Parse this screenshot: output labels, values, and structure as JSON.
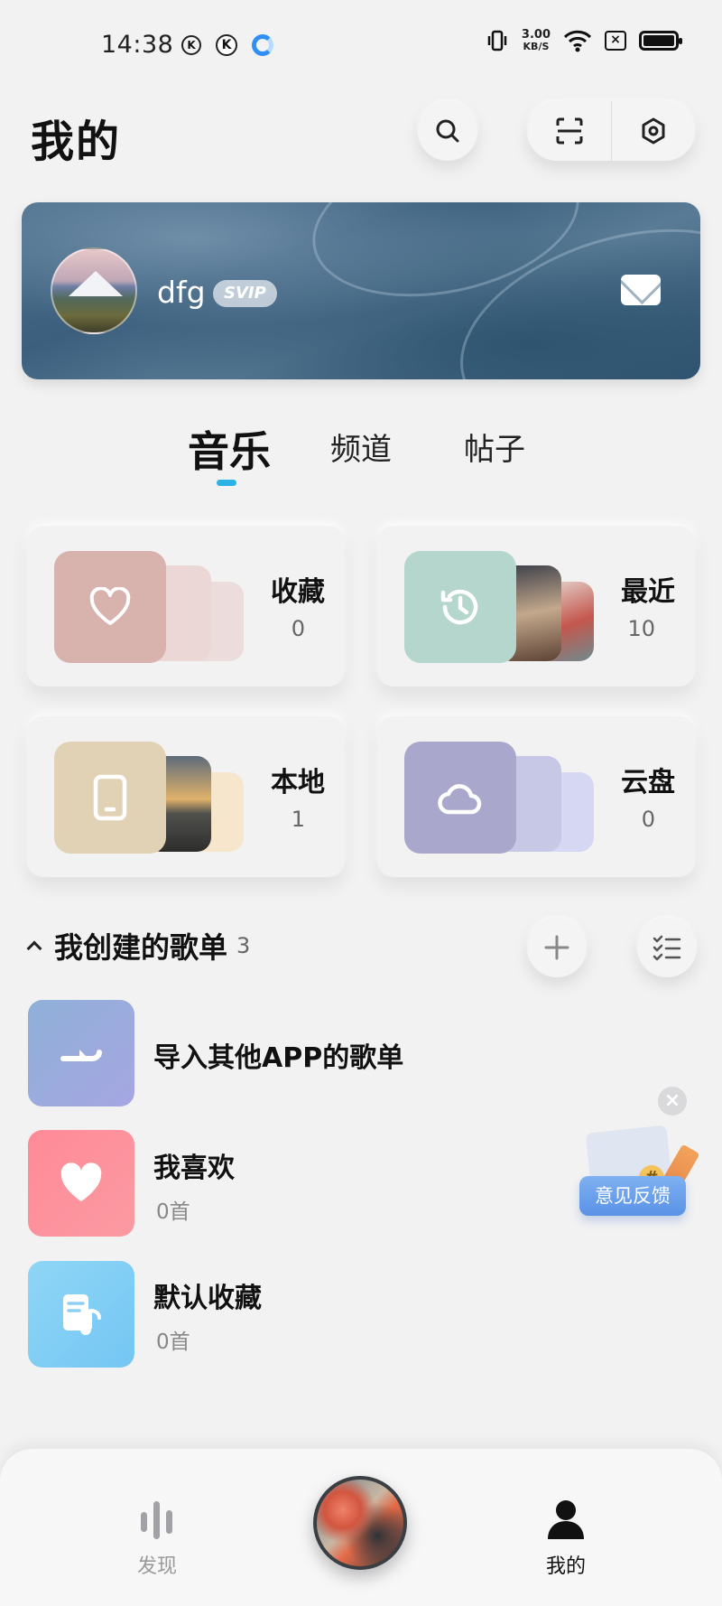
{
  "status_bar": {
    "time": "14:38",
    "k_badge": "K",
    "net_speed": "3.00",
    "net_unit": "KB/S"
  },
  "header": {
    "title": "我的",
    "search_icon": "search-icon",
    "scan_icon": "scan-icon",
    "settings_icon": "hexagon-settings-icon"
  },
  "profile": {
    "username": "dfg",
    "badge": "SVIP",
    "mail_icon": "mail-icon"
  },
  "tabs": [
    {
      "label": "音乐",
      "active": true
    },
    {
      "label": "频道",
      "active": false
    },
    {
      "label": "帖子",
      "active": false
    }
  ],
  "shortcuts": [
    {
      "label": "收藏",
      "count": "0",
      "icon": "heart-icon",
      "color": "#d8b2ad"
    },
    {
      "label": "最近",
      "count": "10",
      "icon": "clock-icon",
      "color": "#b4d6cc"
    },
    {
      "label": "本地",
      "count": "1",
      "icon": "phone-icon",
      "color": "#e1d2b6"
    },
    {
      "label": "云盘",
      "count": "0",
      "icon": "cloud-icon",
      "color": "#a9a8cc"
    }
  ],
  "playlists_section": {
    "title": "我创建的歌单",
    "count": "3"
  },
  "playlists": [
    {
      "title": "导入其他APP的歌单",
      "subtitle": "",
      "icon": "import-arrow-icon"
    },
    {
      "title": "我喜欢",
      "subtitle": "0首",
      "icon": "heart-icon"
    },
    {
      "title": "默认收藏",
      "subtitle": "0首",
      "icon": "music-note-doc-icon"
    }
  ],
  "feedback": {
    "label": "意见反馈",
    "close": "×",
    "hash": "#"
  },
  "bottom_nav": {
    "discover": "发现",
    "mine": "我的"
  }
}
